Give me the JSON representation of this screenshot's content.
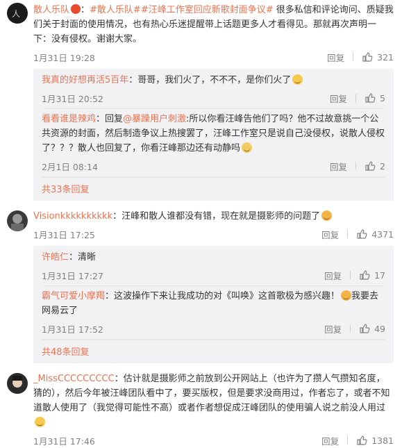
{
  "comments": [
    {
      "user": "散人乐队",
      "colon": "：",
      "topics": [
        "#散人乐队#",
        "#汪峰工作室回应新歌封面争议#"
      ],
      "text": "很多私信和评论询问、质疑我们关于封面的使用情况，也有热心乐迷提醒带上话题更多人才看得见。那就再次声明一下：没有侵权。谢谢大家。",
      "time": "1月31日 19:28",
      "reply_label": "回复",
      "likes": "321",
      "subs": [
        {
          "user": "我真的好想再活5百年",
          "text": "：哥哥，我们火了，不不不，是你们火了",
          "time": "1月31日 20:52",
          "reply_label": "回复",
          "likes": "5"
        },
        {
          "user": "看看谁是辣鸡",
          "text": "：回复",
          "mention": "@暴躁用户刺激",
          "text2": ":所以你看汪峰告他们了吗？他不过故意挑一个公共资源的封面，然后制造争议上热搜罢了，汪峰工作室只是说自己没侵权，说散人侵权了？？？散人也回复了，你看汪峰那边还有动静吗",
          "time": "2月1日 08:14",
          "reply_label": "回复",
          "likes": "2"
        }
      ],
      "more": "共33条回复"
    },
    {
      "user": "Visionkkkkkkkkkk",
      "colon": "：",
      "text": "汪峰和散人谁都没有错，现在就是摄影师的问题了",
      "time": "1月31日 17:25",
      "reply_label": "回复",
      "likes": "4371",
      "subs": [
        {
          "user": "许皓仁",
          "text": "：清晰",
          "time": "1月31日 17:27",
          "reply_label": "回复",
          "likes": "17"
        },
        {
          "user": "霸气可爱小摩羯",
          "text": "：这波操作下来让我成功的对《叫唤》这首歌极为感兴趣！",
          "text_after": "我要去网易云了",
          "time": "1月31日 17:52",
          "reply_label": "回复",
          "likes": "49"
        }
      ],
      "more": "共48条回复"
    },
    {
      "user": "_MissCCCCCCCCC",
      "colon": "：",
      "text": "估计就是摄影师之前放到公开网站上（也许为了攒人气攒知名度，猜的），然后今年被汪峰团队看中了，要买版权，但是要求没商用过，作者忘了，或者不知道散人使用了（我觉得可能性不高）或者作者想促成汪峰团队的使用骗人说之前没人用过",
      "time": "1月31日 17:46",
      "reply_label": "回复",
      "likes": "1381"
    }
  ],
  "icons": {
    "like": "thumbs-up-icon",
    "badge": "verified-badge-icon",
    "emoji": "laugh-emoji-icon"
  },
  "colors": {
    "accent": "#eb7350",
    "sub_bg": "#f2f2f5"
  }
}
